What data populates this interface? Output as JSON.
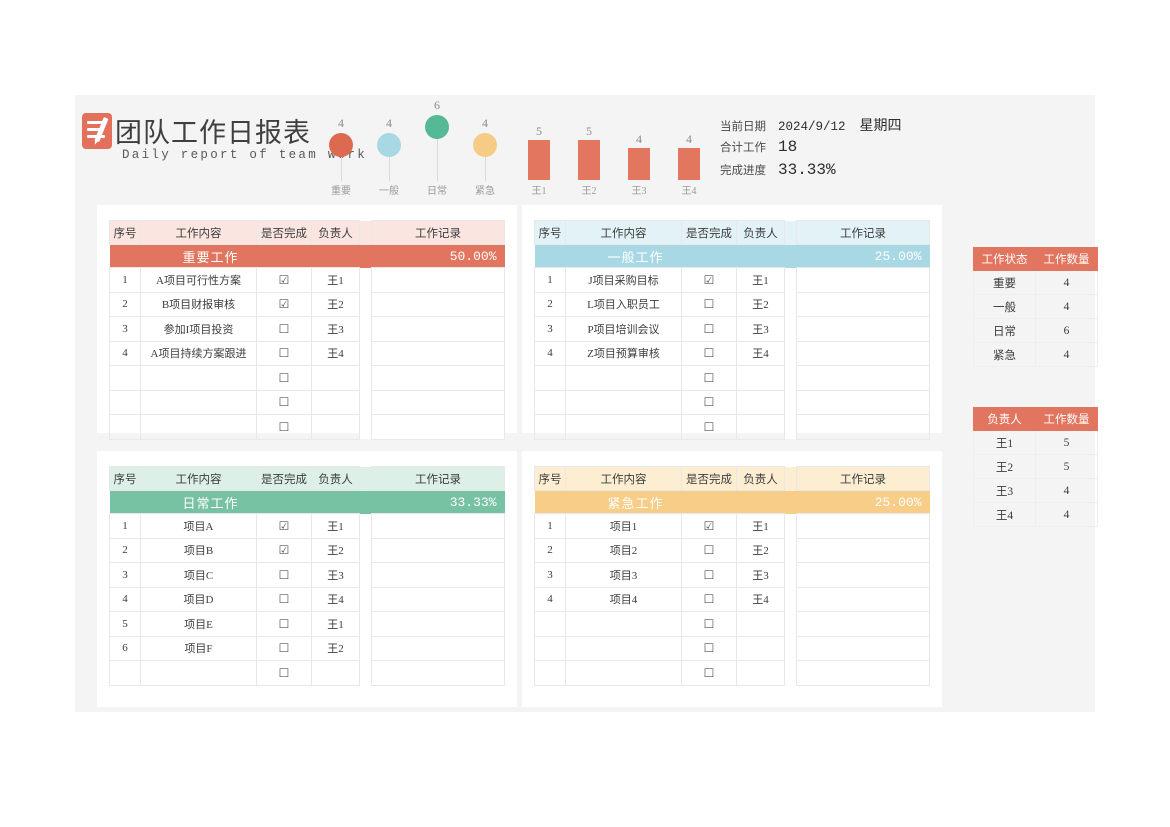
{
  "header": {
    "logo_icon": "document-pencil-icon",
    "title_cn": "团队工作日报表",
    "title_en": "Daily report of team work"
  },
  "meta": {
    "date_label": "当前日期",
    "date_value": "2024/9/12",
    "weekday": "星期四",
    "total_label": "合计工作",
    "total_value": "18",
    "progress_label": "完成进度",
    "progress_value": "33.33%"
  },
  "chart_data": [
    {
      "type": "scatter",
      "name": "category-lollipop",
      "title": "",
      "categories": [
        "重要",
        "一般",
        "日常",
        "紧急"
      ],
      "values": [
        4,
        4,
        6,
        4
      ],
      "colors": [
        "#dd6a50",
        "#a8d8e4",
        "#55b995",
        "#f5cb86"
      ],
      "ylim": [
        0,
        6
      ],
      "xlabel": "",
      "ylabel": "",
      "grid": false,
      "legend": "none"
    },
    {
      "type": "bar",
      "name": "owner-bars",
      "title": "",
      "categories": [
        "王1",
        "王2",
        "王3",
        "王4"
      ],
      "values": [
        5,
        5,
        4,
        4
      ],
      "color": "#e2765f",
      "ylim": [
        0,
        5
      ],
      "xlabel": "",
      "ylabel": "",
      "grid": false,
      "legend": "none"
    }
  ],
  "columns": {
    "no": "序号",
    "task": "工作内容",
    "done": "是否完成",
    "owner": "负责人",
    "record": "工作记录"
  },
  "checkbox": {
    "checked": "☑",
    "unchecked": "☐"
  },
  "tables": [
    {
      "title": "重要工作",
      "percent": "50.00%",
      "theme": "red",
      "rows": [
        {
          "no": "1",
          "task": "A项目可行性方案",
          "done": "☑",
          "owner": "王1",
          "record": ""
        },
        {
          "no": "2",
          "task": "B项目财报审核",
          "done": "☑",
          "owner": "王2",
          "record": ""
        },
        {
          "no": "3",
          "task": "参加I项目投资",
          "done": "☐",
          "owner": "王3",
          "record": ""
        },
        {
          "no": "4",
          "task": "A项目持续方案跟进",
          "done": "☐",
          "owner": "王4",
          "record": ""
        },
        {
          "no": "",
          "task": "",
          "done": "☐",
          "owner": "",
          "record": ""
        },
        {
          "no": "",
          "task": "",
          "done": "☐",
          "owner": "",
          "record": ""
        },
        {
          "no": "",
          "task": "",
          "done": "☐",
          "owner": "",
          "record": ""
        }
      ]
    },
    {
      "title": "一般工作",
      "percent": "25.00%",
      "theme": "blue",
      "rows": [
        {
          "no": "1",
          "task": "J项目采购目标",
          "done": "☑",
          "owner": "王1",
          "record": ""
        },
        {
          "no": "2",
          "task": "L项目入职员工",
          "done": "☐",
          "owner": "王2",
          "record": ""
        },
        {
          "no": "3",
          "task": "P项目培训会议",
          "done": "☐",
          "owner": "王3",
          "record": ""
        },
        {
          "no": "4",
          "task": "Z项目预算审核",
          "done": "☐",
          "owner": "王4",
          "record": ""
        },
        {
          "no": "",
          "task": "",
          "done": "☐",
          "owner": "",
          "record": ""
        },
        {
          "no": "",
          "task": "",
          "done": "☐",
          "owner": "",
          "record": ""
        },
        {
          "no": "",
          "task": "",
          "done": "☐",
          "owner": "",
          "record": ""
        }
      ]
    },
    {
      "title": "日常工作",
      "percent": "33.33%",
      "theme": "green",
      "rows": [
        {
          "no": "1",
          "task": "项目A",
          "done": "☑",
          "owner": "王1",
          "record": ""
        },
        {
          "no": "2",
          "task": "项目B",
          "done": "☑",
          "owner": "王2",
          "record": ""
        },
        {
          "no": "3",
          "task": "项目C",
          "done": "☐",
          "owner": "王3",
          "record": ""
        },
        {
          "no": "4",
          "task": "项目D",
          "done": "☐",
          "owner": "王4",
          "record": ""
        },
        {
          "no": "5",
          "task": "项目E",
          "done": "☐",
          "owner": "王1",
          "record": ""
        },
        {
          "no": "6",
          "task": "项目F",
          "done": "☐",
          "owner": "王2",
          "record": ""
        },
        {
          "no": "",
          "task": "",
          "done": "☐",
          "owner": "",
          "record": ""
        }
      ]
    },
    {
      "title": "紧急工作",
      "percent": "25.00%",
      "theme": "orange",
      "rows": [
        {
          "no": "1",
          "task": "项目1",
          "done": "☑",
          "owner": "王1",
          "record": ""
        },
        {
          "no": "2",
          "task": "项目2",
          "done": "☐",
          "owner": "王2",
          "record": ""
        },
        {
          "no": "3",
          "task": "项目3",
          "done": "☐",
          "owner": "王3",
          "record": ""
        },
        {
          "no": "4",
          "task": "项目4",
          "done": "☐",
          "owner": "王4",
          "record": ""
        },
        {
          "no": "",
          "task": "",
          "done": "☐",
          "owner": "",
          "record": ""
        },
        {
          "no": "",
          "task": "",
          "done": "☐",
          "owner": "",
          "record": ""
        },
        {
          "no": "",
          "task": "",
          "done": "☐",
          "owner": "",
          "record": ""
        }
      ]
    }
  ],
  "summary_status": {
    "headers": [
      "工作状态",
      "工作数量"
    ],
    "rows": [
      {
        "k": "重要",
        "v": "4"
      },
      {
        "k": "一般",
        "v": "4"
      },
      {
        "k": "日常",
        "v": "6"
      },
      {
        "k": "紧急",
        "v": "4"
      }
    ]
  },
  "summary_owner": {
    "headers": [
      "负责人",
      "工作数量"
    ],
    "rows": [
      {
        "k": "王1",
        "v": "5"
      },
      {
        "k": "王2",
        "v": "5"
      },
      {
        "k": "王3",
        "v": "4"
      },
      {
        "k": "王4",
        "v": "4"
      }
    ]
  },
  "colors": {
    "accent_red": "#e1755f",
    "accent_blue": "#a8d8e4",
    "accent_green": "#77c2a3",
    "accent_orange": "#f7cd88",
    "canvas": "#f4f4f4"
  }
}
